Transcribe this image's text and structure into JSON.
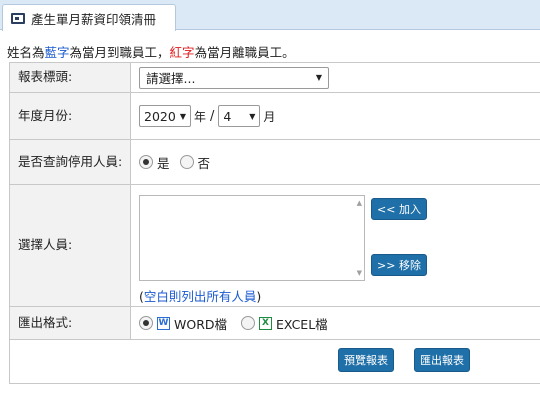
{
  "tab": {
    "title": "產生單月薪資印領清冊",
    "icon": "report-icon"
  },
  "note": {
    "p1": "姓名為",
    "blue_word": "藍字",
    "p2": "為當月到職員工，",
    "red_word": "紅字",
    "p3": "為當月離職員工。"
  },
  "form": {
    "report_header": {
      "label": "報表標頭:",
      "selected": "請選擇..."
    },
    "year_month": {
      "label": "年度月份:",
      "year": "2020",
      "year_suffix": "年",
      "separator": "/",
      "month": "4",
      "month_suffix": "月"
    },
    "include_inactive": {
      "label": "是否查詢停用人員:",
      "yes": "是",
      "no": "否",
      "selected": "yes"
    },
    "select_staff": {
      "label": "選擇人員:",
      "add_button": "<< 加入",
      "remove_button": ">> 移除",
      "hint_open": "(",
      "hint_text": "空白則列出所有人員",
      "hint_close": ")"
    },
    "export_format": {
      "label": "匯出格式:",
      "word_label": "WORD檔",
      "excel_label": "EXCEL檔",
      "word_icon": "W",
      "excel_icon": "X",
      "selected": "word"
    },
    "actions": {
      "preview": "預覽報表",
      "export": "匯出報表"
    }
  },
  "colors": {
    "accent_button": "#1f6fa8",
    "blue_text": "#1c5bd1",
    "red_text": "#e0181b",
    "header_bg": "#dbe8f5",
    "label_bg": "#f2f2f2"
  }
}
